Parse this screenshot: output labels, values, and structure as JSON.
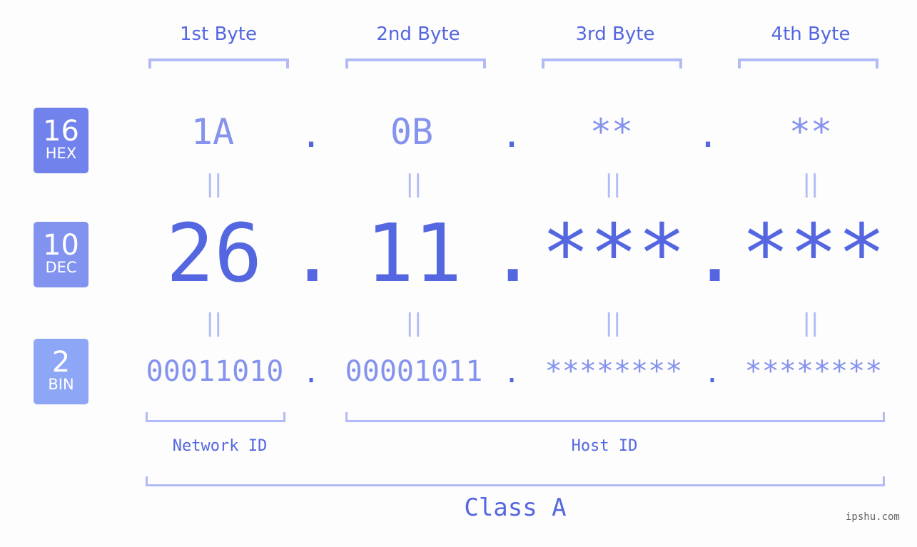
{
  "badges": [
    {
      "num": "16",
      "label": "HEX",
      "color": "#7182ec"
    },
    {
      "num": "10",
      "label": "DEC",
      "color": "#8293ef"
    },
    {
      "num": "2",
      "label": "BIN",
      "color": "#8ea6f6"
    }
  ],
  "bytes": [
    {
      "label": "1st Byte",
      "hex": "1A",
      "dec": "26",
      "bin": "00011010"
    },
    {
      "label": "2nd Byte",
      "hex": "0B",
      "dec": "11",
      "bin": "00001011"
    },
    {
      "label": "3rd Byte",
      "hex": "**",
      "dec": "***",
      "bin": "********"
    },
    {
      "label": "4th Byte",
      "hex": "**",
      "dec": "***",
      "bin": "********"
    }
  ],
  "separator": ".",
  "equals": "||",
  "network_id_label": "Network ID",
  "host_id_label": "Host ID",
  "class_label": "Class A",
  "watermark": "ipshu.com"
}
